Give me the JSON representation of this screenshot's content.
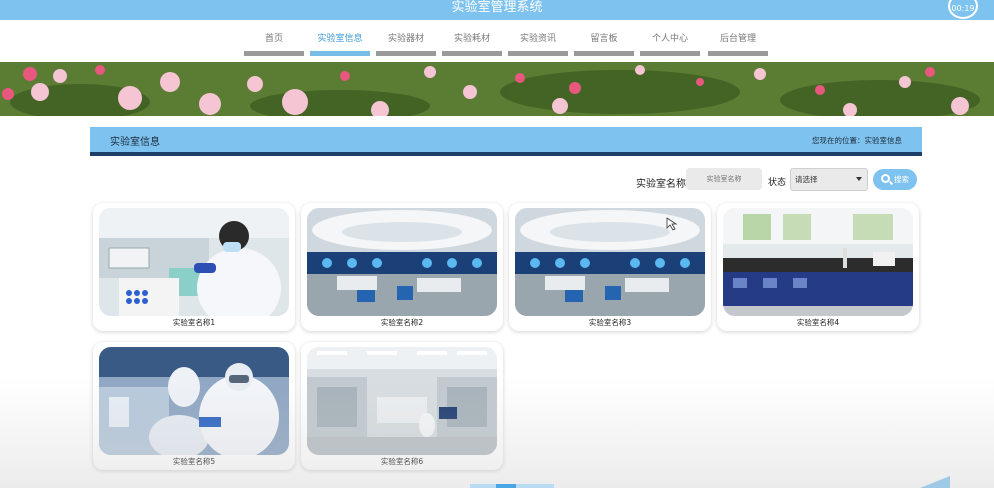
{
  "app": {
    "title": "实验室管理系统",
    "timer": "00:19"
  },
  "nav": {
    "items": [
      {
        "label": "首页"
      },
      {
        "label": "实验室信息"
      },
      {
        "label": "实验器材"
      },
      {
        "label": "实验耗材"
      },
      {
        "label": "实验资讯"
      },
      {
        "label": "留言板"
      },
      {
        "label": "个人中心"
      },
      {
        "label": "后台管理"
      }
    ],
    "active_index": 1,
    "active_color": "#78bce9"
  },
  "section": {
    "title": "实验室信息",
    "breadcrumb": "您现在的位置：实验室信息"
  },
  "search": {
    "name_label": "实验室名称",
    "name_placeholder": "实验室名称",
    "status_label": "状态",
    "status_selected": "请选择",
    "search_button": "搜索"
  },
  "cards": [
    {
      "caption": "实验室名称1",
      "image": "scientist-pipetting"
    },
    {
      "caption": "实验室名称2",
      "image": "futuristic-lab"
    },
    {
      "caption": "实验室名称3",
      "image": "futuristic-lab"
    },
    {
      "caption": "实验室名称4",
      "image": "lab-benches"
    },
    {
      "caption": "实验室名称5",
      "image": "cleanroom-workers"
    },
    {
      "caption": "实验室名称6",
      "image": "industrial-lab"
    }
  ],
  "colors": {
    "accent": "#7ec3ef",
    "head_border": "#1d3e66"
  }
}
